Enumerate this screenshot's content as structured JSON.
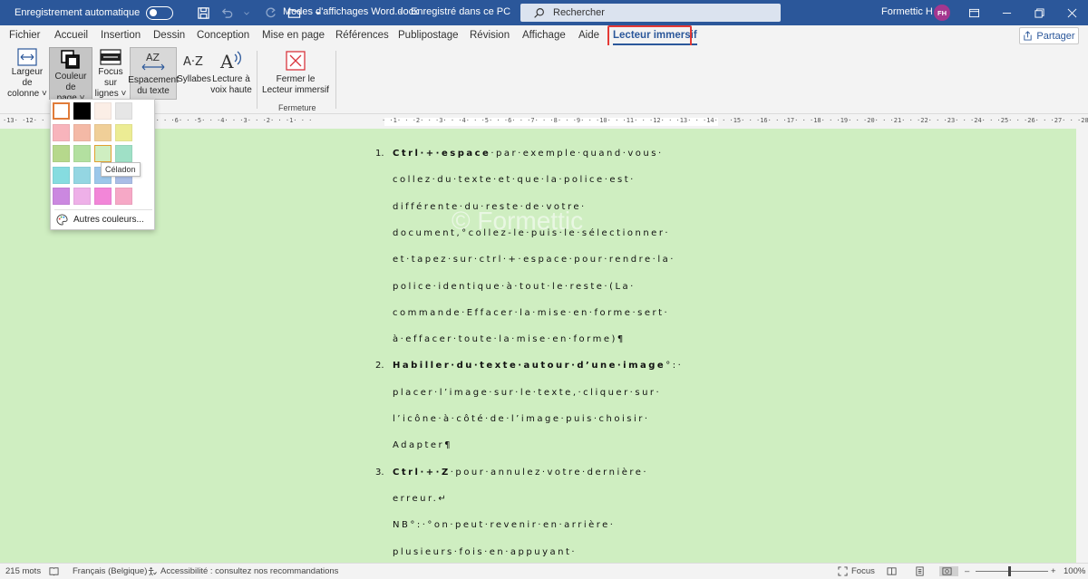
{
  "titlebar": {
    "autosave_label": "Enregistrement automatique",
    "doc_name": "Modes d'affichages Word.docx",
    "doc_state": "Enregistré dans ce PC",
    "search_placeholder": "Rechercher",
    "user_name": "Formettic H",
    "user_initials": "FH"
  },
  "tabs": [
    "Fichier",
    "Accueil",
    "Insertion",
    "Dessin",
    "Conception",
    "Mise en page",
    "Références",
    "Publipostage",
    "Révision",
    "Affichage",
    "Aide",
    "Lecteur immersif"
  ],
  "share_label": "Partager",
  "ribbon": {
    "column_width": [
      "Largeur de",
      "colonne"
    ],
    "page_color": [
      "Couleur de",
      "page"
    ],
    "line_focus": [
      "Focus sur",
      "lignes"
    ],
    "text_spacing": [
      "Espacement",
      "du texte"
    ],
    "syllables": "Syllabes",
    "read_aloud": [
      "Lecture à",
      "voix haute"
    ],
    "close_reader": [
      "Fermer le",
      "Lecteur immersif"
    ],
    "group_close": "Fermeture"
  },
  "ruler_text": "·13· ·12· · ·11· · ·10· · ·9· · ·8· · ·7· · ·6· · ·5· · ·4· · ·3· · ·2· · ·1· · ·",
  "ruler_text_right": "· ·1· · ·2· · ·3· · ·4· · ·5· · ·6· · ·7· · ·8· · ·9· · ·10· · ·11· · ·12· · ·13· · ·14· · ·15· · ·16· · ·17· · ·18· · ·19· · ·20· · ·21· · ·22· · ·23· · ·24· · ·25· · ·26· · ·27· · ·28·",
  "color_popup": {
    "swatches": [
      [
        "#ffffff",
        "#000000",
        "#fbeee6",
        "#e6e6e6"
      ],
      [
        "#f8b4bc",
        "#f4b9a6",
        "#f0cf98",
        "#ecec94"
      ],
      [
        "#b6d88c",
        "#b3e0a0",
        "#cfeec1",
        "#9fe0c6"
      ],
      [
        "#86dce0",
        "#94d6e2",
        "#9cc7ea",
        "#a9bde6"
      ],
      [
        "#cb88e0",
        "#eeb0e8",
        "#f286d8",
        "#f6a8c6"
      ]
    ],
    "more_colors": "Autres couleurs...",
    "tooltip": "Céladon"
  },
  "watermark": "© Formettic",
  "document": {
    "lines": [
      {
        "num": "1.",
        "bold": "Ctrl·+·espace",
        "text": "·par·exemple·quand·vous·"
      },
      {
        "text": "collez·du·texte·et·que·la·police·est·"
      },
      {
        "text": "différente·du·reste·de·votre·"
      },
      {
        "text": "document,°collez-le·puis·le·sélectionner·"
      },
      {
        "text": "et·tapez·sur·ctrl·+·espace·pour·rendre·la·"
      },
      {
        "text": "police·identique·à·tout·le·reste·(La·"
      },
      {
        "text": "commande·Effacer·la·mise·en·forme·sert·"
      },
      {
        "text": "à·effacer·toute·la·mise·en·forme)¶"
      },
      {
        "num": "2.",
        "bold": "Habiller·du·texte·autour·d’une·image",
        "text": "°:·"
      },
      {
        "text": "placer·l’image·sur·le·texte,·cliquer·sur·"
      },
      {
        "text": "l’icône·à·côté·de·l’image·puis·choisir·"
      },
      {
        "text": "Adapter¶"
      },
      {
        "num": "3.",
        "bold": "Ctrl·+·Z",
        "text": "·pour·annulez·votre·dernière·"
      },
      {
        "text": "erreur.↵"
      },
      {
        "text": "NB°:·°on·peut·revenir·en·arrière·"
      },
      {
        "text": "plusieurs·fois·en·appuyant·"
      }
    ]
  },
  "status": {
    "words": "215 mots",
    "language": "Français (Belgique)",
    "accessibility": "Accessibilité : consultez nos recommandations",
    "focus": "Focus",
    "zoom": "100%"
  }
}
